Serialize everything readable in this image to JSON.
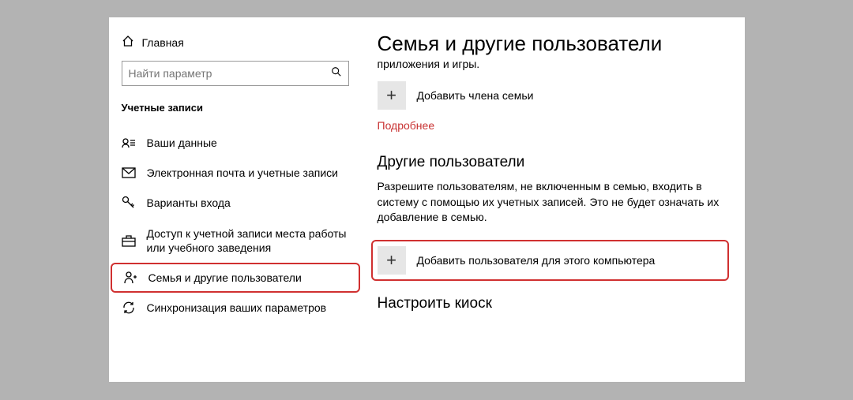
{
  "sidebar": {
    "home_label": "Главная",
    "search_placeholder": "Найти параметр",
    "section_title": "Учетные записи",
    "items": [
      {
        "label": "Ваши данные"
      },
      {
        "label": "Электронная почта и учетные записи"
      },
      {
        "label": "Варианты входа"
      },
      {
        "label": "Доступ к учетной записи места работы или учебного заведения"
      },
      {
        "label": "Семья и другие пользователи"
      },
      {
        "label": "Синхронизация ваших параметров"
      }
    ]
  },
  "content": {
    "title": "Семья и другие пользователи",
    "subtitle": "приложения и игры.",
    "add_family_label": "Добавить члена семьи",
    "more_link": "Подробнее",
    "other_users_header": "Другие пользователи",
    "other_users_desc": "Разрешите пользователям, не включенным в семью, входить в систему с помощью их учетных записей. Это не будет означать их добавление в семью.",
    "add_user_label": "Добавить пользователя для этого компьютера",
    "kiosk_header": "Настроить киоск"
  }
}
